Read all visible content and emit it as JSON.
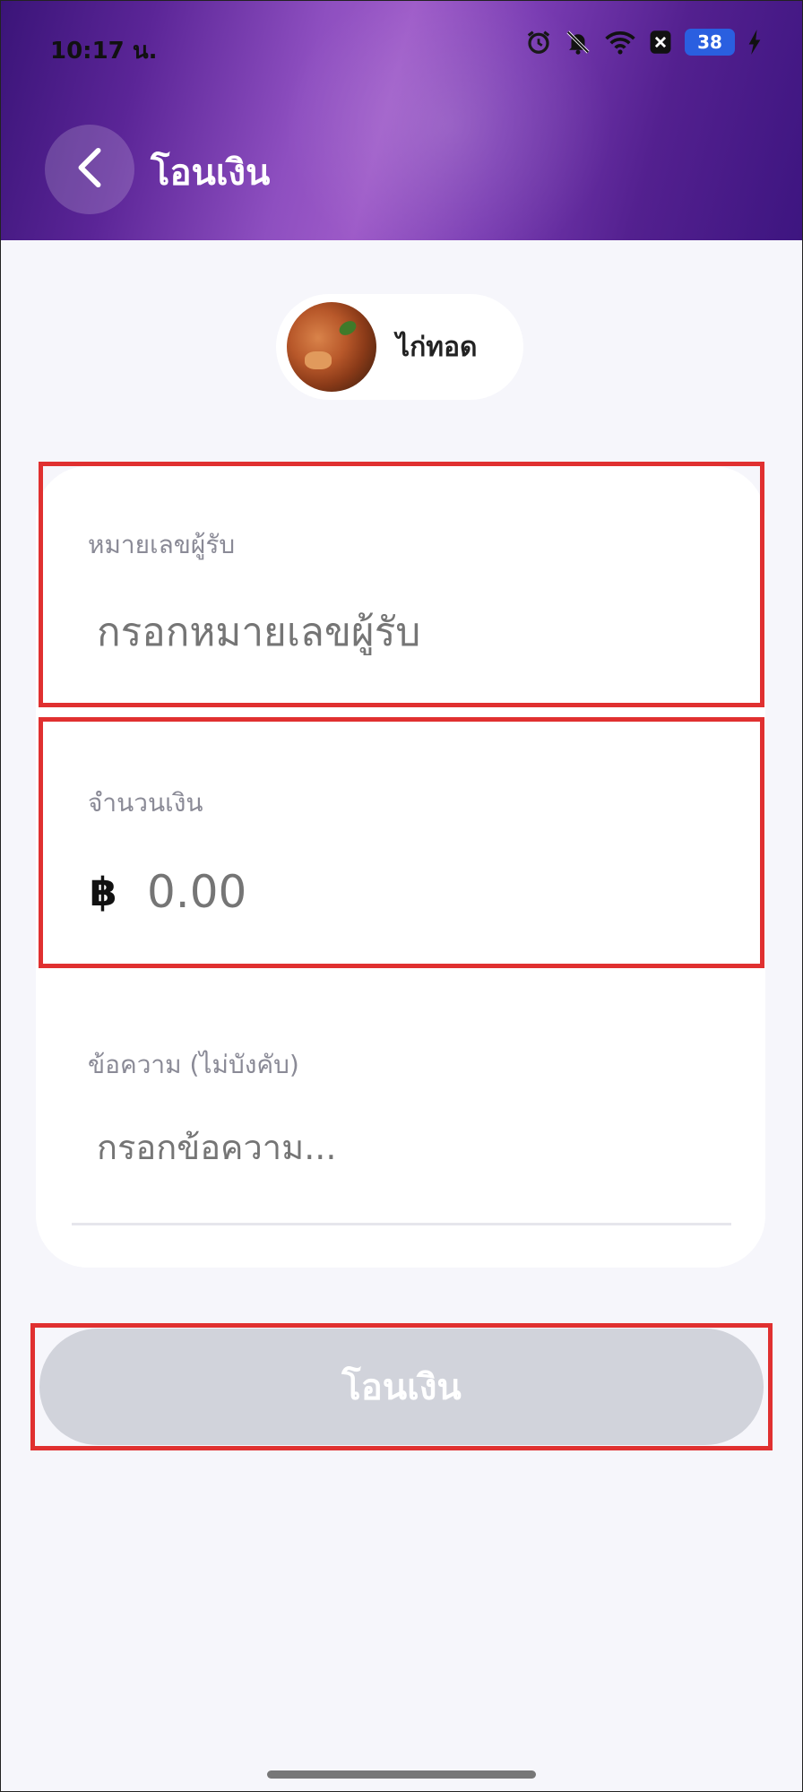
{
  "status_bar": {
    "time": "10:17 น.",
    "battery": "38",
    "icons": [
      "alarm-icon",
      "bell-off-icon",
      "wifi-icon",
      "notification-x-icon",
      "battery-icon",
      "charging-icon"
    ]
  },
  "header": {
    "title": "โอนเงิน",
    "back_icon": "chevron-left-icon"
  },
  "account_chip": {
    "name": "ไก่ทอด"
  },
  "form": {
    "recipient": {
      "label": "หมายเลขผู้รับ",
      "placeholder": "กรอกหมายเลขผู้รับ",
      "value": ""
    },
    "amount": {
      "label": "จำนวนเงิน",
      "currency_symbol": "฿",
      "placeholder": "0.00",
      "value": ""
    },
    "message": {
      "label": "ข้อความ (ไม่บังคับ)",
      "placeholder": "กรอกข้อความ...",
      "value": ""
    }
  },
  "submit": {
    "label": "โอนเงิน",
    "enabled": false
  },
  "colors": {
    "header_gradient_dark": "#3a1478",
    "header_gradient_light": "#9d5ac8",
    "button_disabled": "#d1d3db",
    "highlight": "#e03030",
    "page_background": "#f6f6fb"
  }
}
